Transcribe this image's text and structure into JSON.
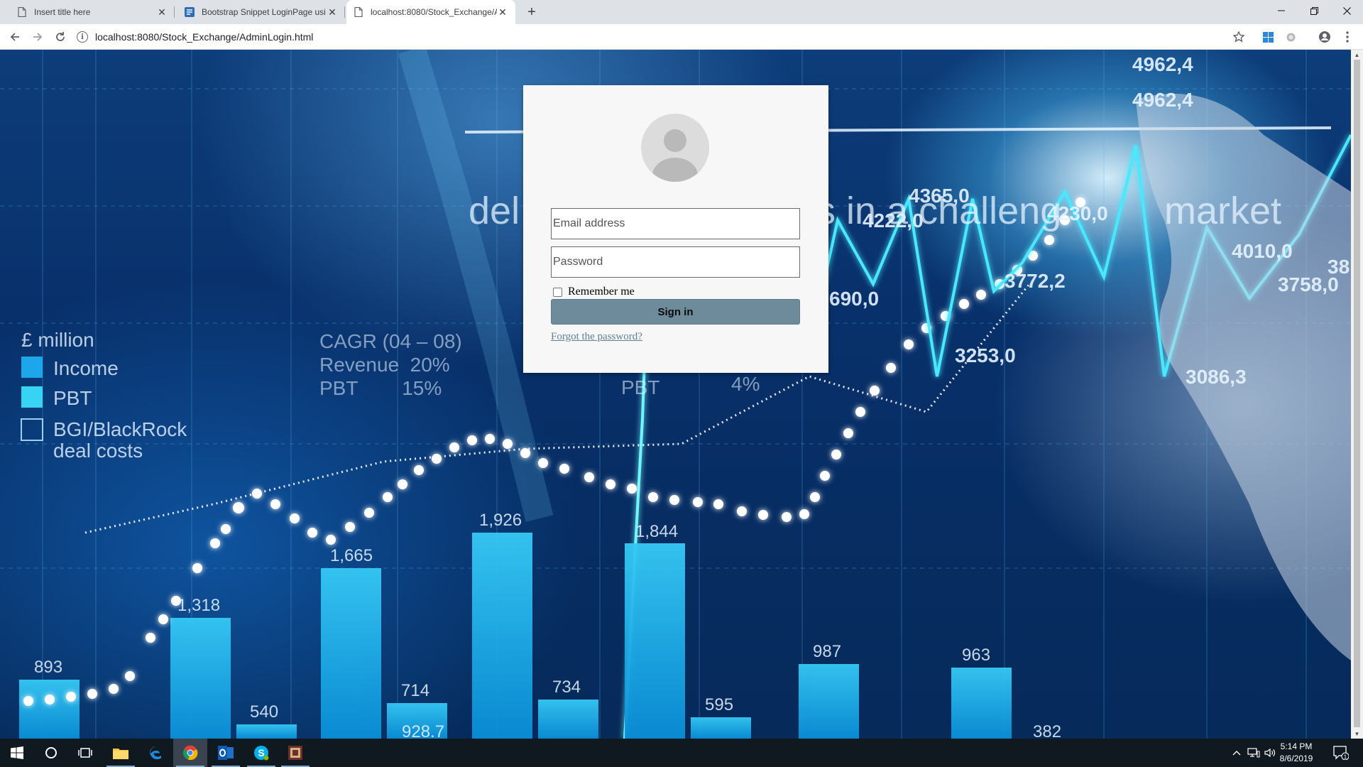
{
  "browser": {
    "tabs": [
      {
        "title": "Insert title here",
        "favicon": "page-icon",
        "active": false
      },
      {
        "title": "Bootstrap Snippet LoginPage usi",
        "favicon": "bootstrap-snippet-icon",
        "active": false
      },
      {
        "title": "localhost:8080/Stock_Exchange/A",
        "favicon": "page-icon",
        "active": true
      }
    ],
    "new_tab_label": "+",
    "address": "localhost:8080/Stock_Exchange/AdminLogin.html"
  },
  "login": {
    "email_placeholder": "Email address",
    "password_placeholder": "Password",
    "remember_label": "Remember me",
    "signin_label": "Sign in",
    "forgot_label": "Forgot the password?"
  },
  "background_chart": {
    "header_text": "del",
    "header_text_2": "s in a challeng",
    "header_text_3": "market",
    "legend_title": "£ million",
    "legend": [
      "Income",
      "PBT",
      "BGI/BlackRock",
      "deal costs"
    ],
    "cagr_label": "CAGR (04 – 08)",
    "cagr_rows": [
      "Revenue  20%",
      "PBT        15%"
    ],
    "pbt_label": "PBT",
    "pbt_value": "4%",
    "bar_labels": [
      "893",
      "1,318",
      "540",
      "1,665",
      "714",
      "1,926",
      "734",
      "1,844",
      "595",
      "987",
      "963",
      "382",
      "928.7"
    ],
    "line_labels": [
      "4962,4",
      "4962,4",
      "4365,0",
      "4222,0",
      "4230,0",
      "4010,0",
      "3772,2",
      "3758,0",
      "3253,0",
      "3086,3",
      "690,0",
      "38"
    ]
  },
  "taskbar": {
    "time": "5:14 PM",
    "date": "8/6/2019",
    "notification_count": "1"
  }
}
